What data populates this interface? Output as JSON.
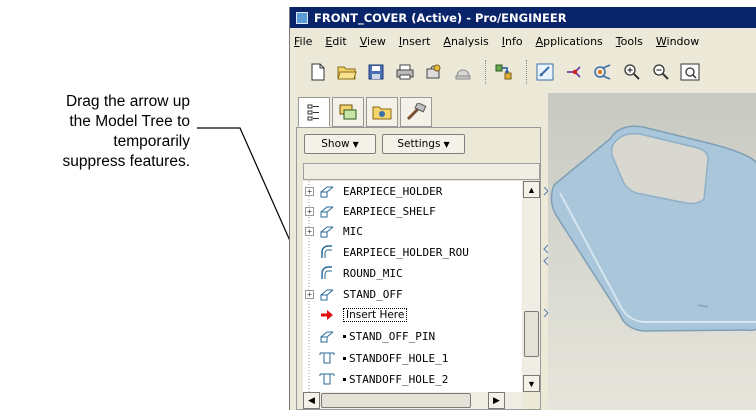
{
  "callout": {
    "lines": [
      "Drag the arrow up",
      "the Model Tree to",
      "temporarily",
      "suppress features."
    ]
  },
  "window": {
    "title": "FRONT_COVER (Active) - Pro/ENGINEER"
  },
  "menubar": {
    "items": [
      "File",
      "Edit",
      "View",
      "Insert",
      "Analysis",
      "Info",
      "Applications",
      "Tools",
      "Window"
    ]
  },
  "toolbar": {
    "icons": [
      "new-file-icon",
      "open-folder-icon",
      "save-icon",
      "print-icon",
      "send-icon",
      "close-window-icon",
      "regenerate-icon",
      "repaint-icon",
      "spin-center-icon",
      "orient-icon",
      "zoom-in-icon",
      "zoom-out-icon",
      "refit-icon"
    ]
  },
  "panel": {
    "tabs": [
      "model-tree-tab-icon",
      "layer-tree-tab-icon",
      "folder-browser-tab-icon",
      "favorites-tab-icon"
    ],
    "show_label": "Show",
    "settings_label": "Settings"
  },
  "tree": {
    "rows": [
      {
        "label": "EARPIECE_HOLDER",
        "expander": true,
        "icon": "extrude"
      },
      {
        "label": "EARPIECE_SHELF",
        "expander": true,
        "icon": "extrude"
      },
      {
        "label": "MIC",
        "expander": true,
        "icon": "extrude"
      },
      {
        "label": "EARPIECE_HOLDER_ROU",
        "expander": false,
        "icon": "round"
      },
      {
        "label": "ROUND_MIC",
        "expander": false,
        "icon": "round"
      },
      {
        "label": "STAND_OFF",
        "expander": true,
        "icon": "extrude"
      },
      {
        "label": "Insert Here",
        "expander": false,
        "icon": "insert-arrow"
      },
      {
        "label": "STAND_OFF_PIN",
        "expander": false,
        "icon": "extrude",
        "suppressed": true
      },
      {
        "label": "STANDOFF_HOLE_1",
        "expander": false,
        "icon": "hole",
        "suppressed": true
      },
      {
        "label": "STANDOFF_HOLE_2",
        "expander": false,
        "icon": "hole",
        "suppressed": true
      }
    ]
  },
  "colors": {
    "title_bar": "#0a246a",
    "insert_arrow": "#e01010",
    "model_surface": "#a9c6da"
  }
}
